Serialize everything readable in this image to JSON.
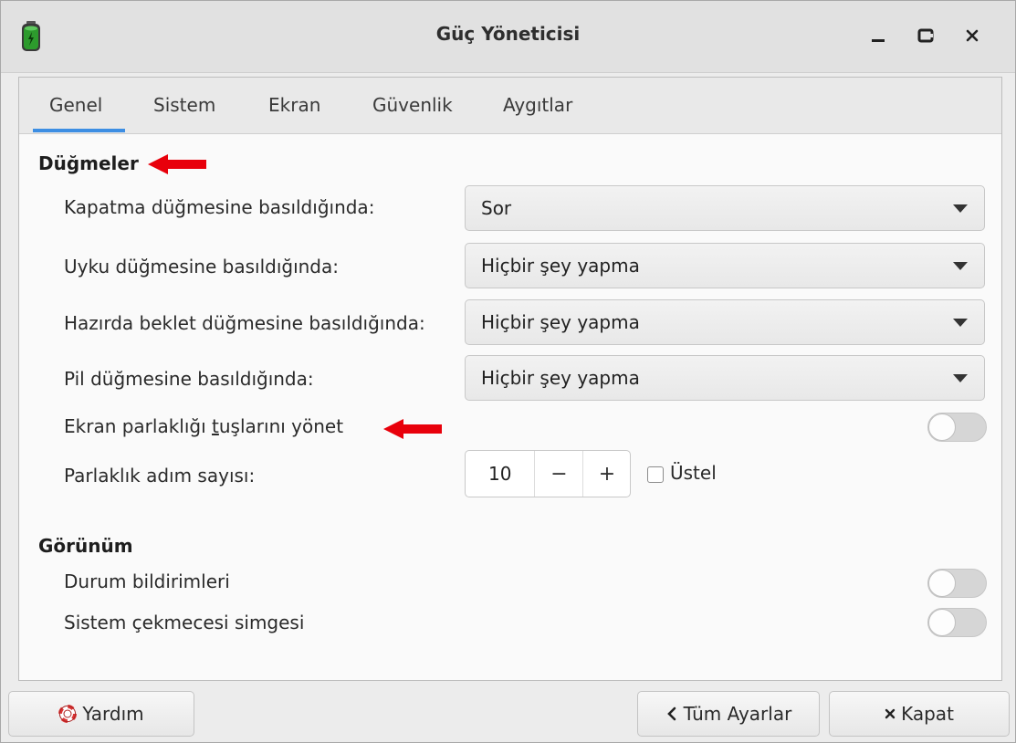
{
  "window": {
    "title": "Güç Yöneticisi"
  },
  "tabs": [
    "Genel",
    "Sistem",
    "Ekran",
    "Güvenlik",
    "Aygıtlar"
  ],
  "active_tab": "Genel",
  "buttons_section": {
    "title": "Düğmeler",
    "rows": [
      {
        "label": "Kapatma düğmesine basıldığında:",
        "value": "Sor"
      },
      {
        "label": "Uyku düğmesine basıldığında:",
        "value": "Hiçbir şey yapma"
      },
      {
        "label": "Hazırda beklet düğmesine basıldığında:",
        "value": "Hiçbir şey yapma"
      },
      {
        "label": "Pil düğmesine basıldığında:",
        "value": "Hiçbir şey yapma"
      }
    ],
    "brightness_keys_label_a": "Ekran parlaklığı ",
    "brightness_keys_label_mnemonic": "t",
    "brightness_keys_label_b": "uşlarını yönet",
    "brightness_keys_enabled": false,
    "brightness_steps_label": "Parlaklık adım sayısı:",
    "brightness_steps_value": "10",
    "minus_symbol": "−",
    "plus_symbol": "+",
    "exponential_label": "Üstel",
    "exponential_checked": false
  },
  "appearance_section": {
    "title": "Görünüm",
    "status_notifications_label": "Durum bildirimleri",
    "status_notifications_enabled": false,
    "tray_icon_label": "Sistem çekmecesi simgesi",
    "tray_icon_enabled": false
  },
  "footer": {
    "help": "Yardım",
    "all_settings": "Tüm Ayarlar",
    "close": "Kapat",
    "back_symbol": "<",
    "close_symbol": "×"
  },
  "colors": {
    "accent": "#3d8ee3",
    "annotation_arrow": "#e8000b",
    "battery": "#2d9b2d"
  },
  "icons": [
    "battery-icon",
    "minimize-icon",
    "maximize-icon",
    "close-icon",
    "help-lifebuoy-icon",
    "back-chevron-icon",
    "close-x-icon"
  ]
}
